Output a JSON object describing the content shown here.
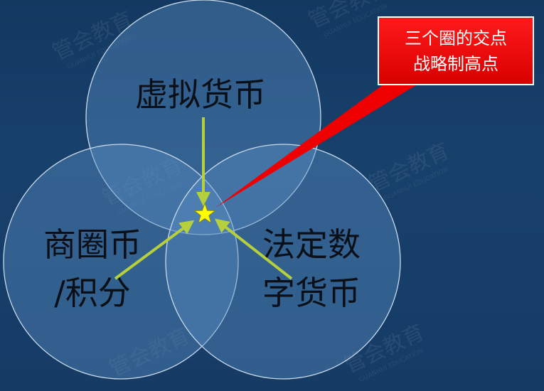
{
  "diagram": {
    "circles": {
      "top": {
        "label_lines": [
          "虚拟货币"
        ]
      },
      "left": {
        "label_lines": [
          "商圈币",
          "/积分"
        ]
      },
      "right": {
        "label_lines": [
          "法定数",
          "字货币"
        ]
      }
    },
    "callout": {
      "lines": [
        "三个圈的交点",
        "战略制高点"
      ]
    },
    "watermark": {
      "text": "管会教育",
      "subtext": "GUANHUI EDUCATION"
    },
    "colors": {
      "background": "#153b64",
      "circle_fill": "#5b8fc4",
      "circle_stroke": "#c9d9ea",
      "arrow": "#b5d03c",
      "star": "#ffff00",
      "callout_fill": "#ee0000"
    }
  }
}
